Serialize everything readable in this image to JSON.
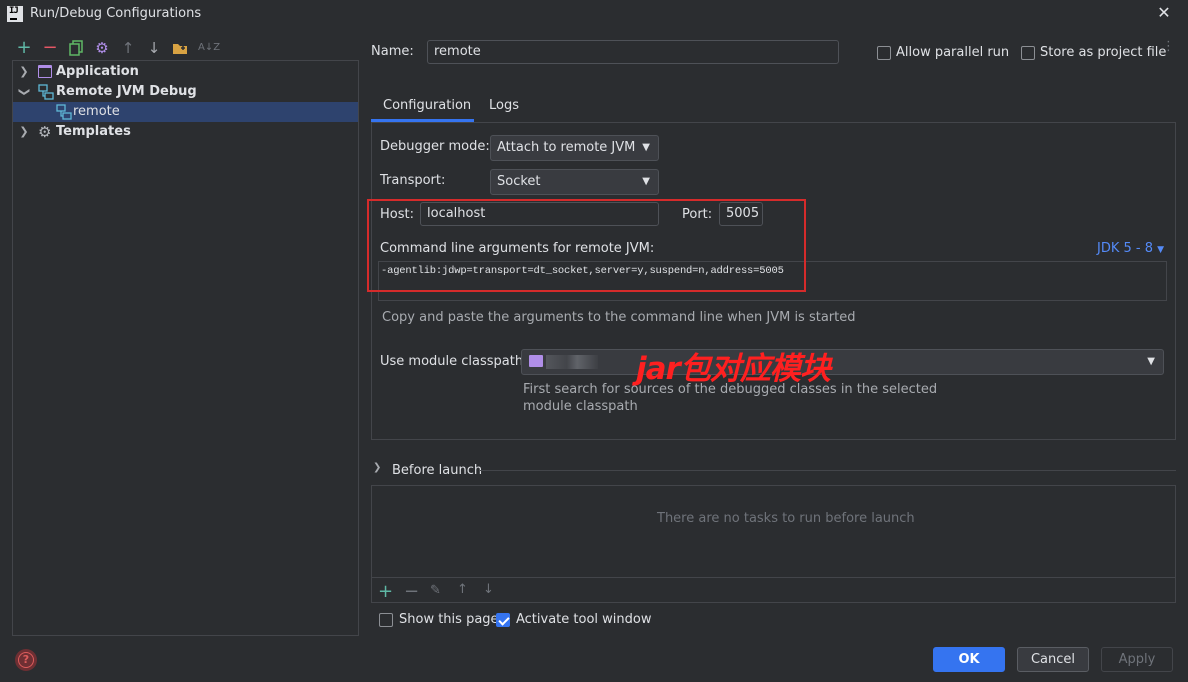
{
  "window": {
    "title": "Run/Debug Configurations",
    "logo_text": "IJ"
  },
  "toolbar": {
    "icons": [
      "add-icon",
      "remove-icon",
      "copy-icon",
      "gear-icon",
      "arrow-up-icon",
      "arrow-down-icon",
      "new-folder-icon",
      "sort-alpha-icon"
    ]
  },
  "tree": {
    "items": [
      {
        "label": "Application",
        "expanded": false
      },
      {
        "label": "Remote JVM Debug",
        "expanded": true
      },
      {
        "label": "remote",
        "selected": true
      },
      {
        "label": "Templates",
        "expanded": false
      }
    ]
  },
  "name_field": {
    "label": "Name:",
    "value": "remote"
  },
  "allow_parallel": {
    "label": "Allow parallel run",
    "checked": false
  },
  "store_as_file": {
    "label": "Store as project file",
    "checked": false
  },
  "tabs": [
    {
      "label": "Configuration",
      "active": true
    },
    {
      "label": "Logs",
      "active": false
    }
  ],
  "debugger_mode": {
    "label": "Debugger mode:",
    "value": "Attach to remote JVM"
  },
  "transport": {
    "label": "Transport:",
    "value": "Socket"
  },
  "host": {
    "label": "Host:",
    "value": "localhost"
  },
  "port": {
    "label": "Port:",
    "value": "5005"
  },
  "cmdline": {
    "label": "Command line arguments for remote JVM:",
    "jdk_link": "JDK 5 - 8",
    "value": "-agentlib:jdwp=transport=dt_socket,server=y,suspend=n,address=5005",
    "hint": "Copy and paste the arguments to the command line when JVM is started"
  },
  "module_classpath": {
    "label": "Use module classpath:",
    "hint_line1": "First search for sources of the debugged classes in the selected",
    "hint_line2": "module classpath"
  },
  "annotation": {
    "text": "jar包对应模块",
    "color": "#ff2020"
  },
  "before_launch": {
    "label": "Before launch",
    "empty_text": "There are no tasks to run before launch"
  },
  "show_page": {
    "label": "Show this page",
    "checked": false
  },
  "activate_tool": {
    "label": "Activate tool window",
    "checked": true
  },
  "buttons": {
    "ok": "OK",
    "cancel": "Cancel",
    "apply": "Apply"
  },
  "colors": {
    "accent": "#3574f0",
    "selection": "#2e436e",
    "highlight_box": "#d52b2b",
    "link": "#548af7"
  }
}
